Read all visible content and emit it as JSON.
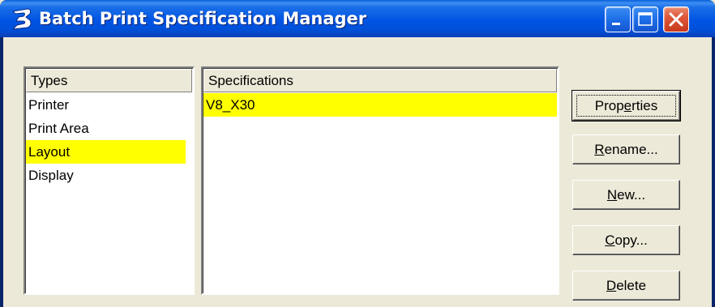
{
  "window": {
    "title": "Batch Print Specification Manager"
  },
  "types": {
    "header": "Types",
    "items": [
      {
        "label": "Printer",
        "selected": false
      },
      {
        "label": "Print Area",
        "selected": false
      },
      {
        "label": "Layout",
        "selected": true
      },
      {
        "label": "Display",
        "selected": false
      }
    ]
  },
  "specifications": {
    "header": "Specifications",
    "items": [
      {
        "label": "V8_X30",
        "selected": true
      }
    ]
  },
  "buttons": {
    "properties": {
      "pre": "Prop",
      "mn": "e",
      "post": "rties"
    },
    "rename": {
      "pre": "",
      "mn": "R",
      "post": "ename..."
    },
    "new": {
      "pre": "",
      "mn": "N",
      "post": "ew..."
    },
    "copy": {
      "pre": "",
      "mn": "C",
      "post": "opy..."
    },
    "delete": {
      "pre": "",
      "mn": "D",
      "post": "elete"
    }
  },
  "colors": {
    "selection": "#ffff00",
    "titlebar": "#0054e3",
    "face": "#ece9d8"
  },
  "icons": {
    "app": "bentley-b-icon",
    "minimize": "minimize-icon",
    "maximize": "maximize-icon",
    "close": "close-icon"
  }
}
